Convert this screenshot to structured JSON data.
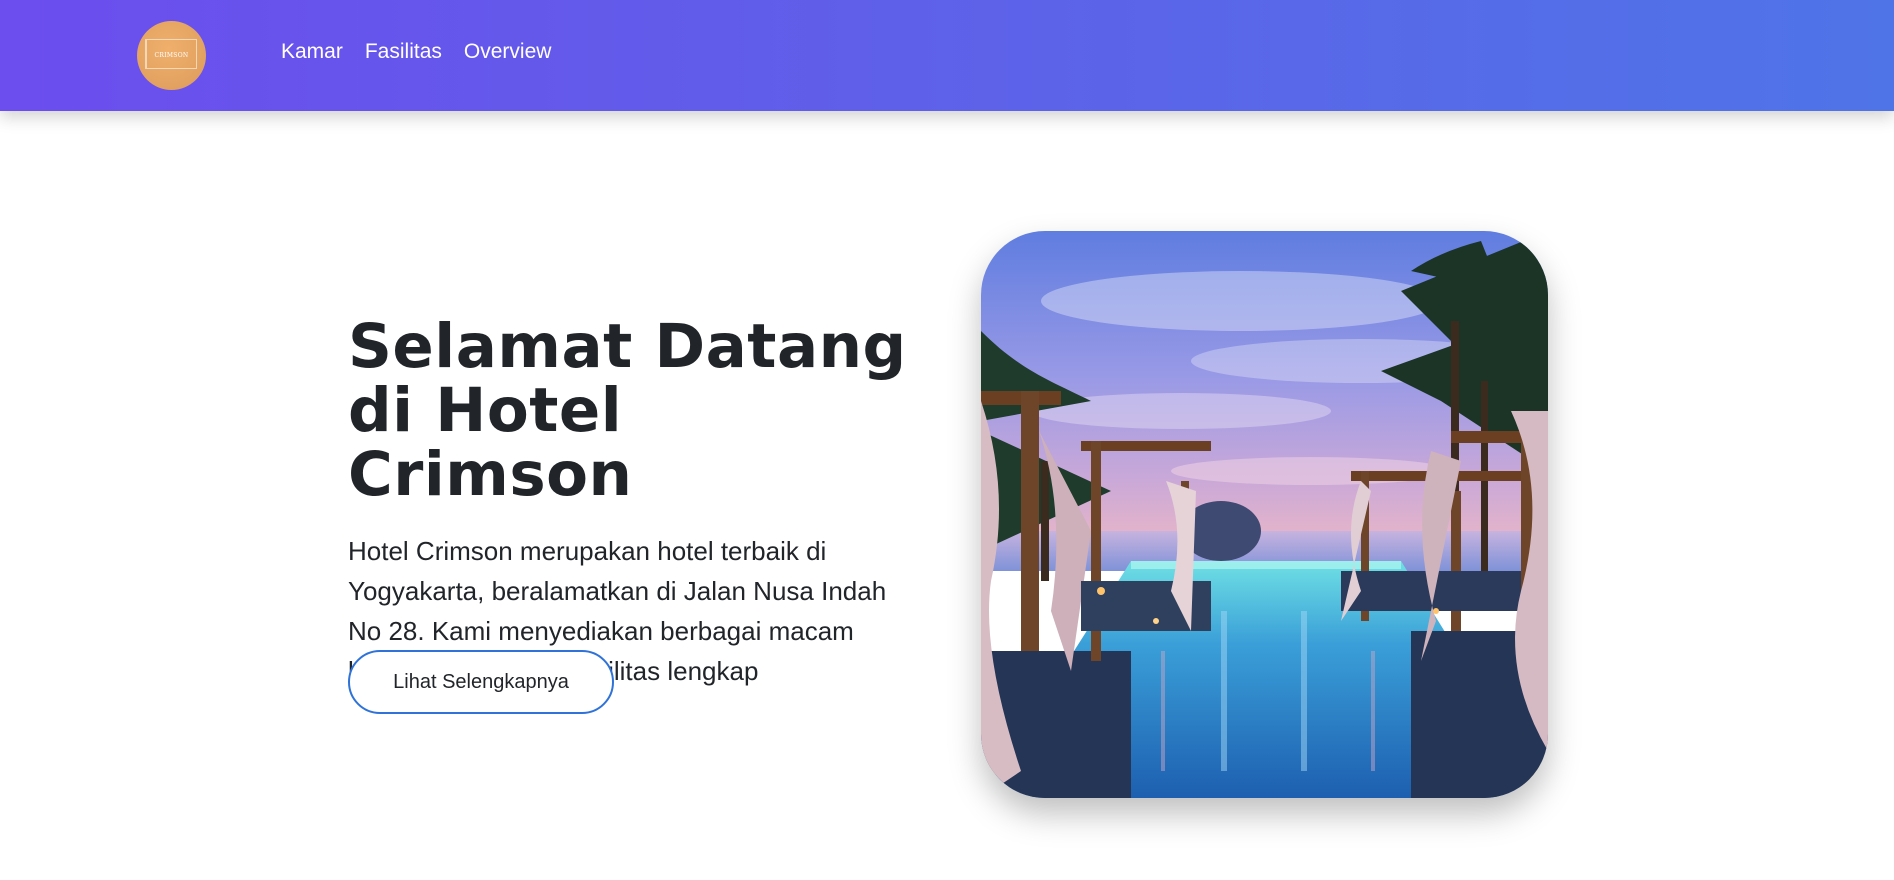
{
  "header": {
    "logo": {
      "text": "CRIMSON",
      "icon": "crimson-logo"
    },
    "nav": [
      {
        "label": "Kamar"
      },
      {
        "label": "Fasilitas"
      },
      {
        "label": "Overview"
      }
    ]
  },
  "hero": {
    "title_line1": "Selamat Datang",
    "title_line2": "di Hotel Crimson",
    "description": "Hotel Crimson merupakan hotel terbaik di Yogyakarta, beralamatkan di Jalan Nusa Indah No 28. Kami menyediakan berbagai macam kamar dan fasilitas-fasilitas lengkap",
    "cta_label": "Lihat Selengkapnya",
    "image": {
      "subject": "infinity pool with canopy daybeds and palm trees at dusk"
    }
  },
  "colors": {
    "navbar_start": "#6c4dee",
    "navbar_end": "#4f74e8",
    "logo": "#e2a160",
    "button_border": "#2f73d8",
    "text": "#212529"
  }
}
